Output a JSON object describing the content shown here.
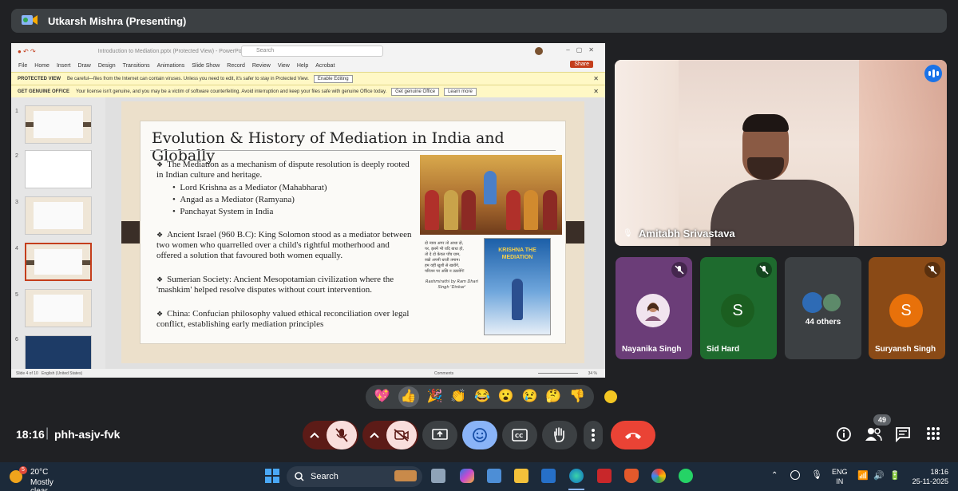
{
  "presenter": {
    "title": "Utkarsh Mishra (Presenting)"
  },
  "powerpoint": {
    "doc_title": "Introduction to Mediation.pptx (Protected View) - PowerPoint",
    "search_placeholder": "Search",
    "menu": [
      "File",
      "Home",
      "Insert",
      "Draw",
      "Design",
      "Transitions",
      "Animations",
      "Slide Show",
      "Record",
      "Review",
      "View",
      "Help",
      "Acrobat"
    ],
    "share_label": "Share",
    "protected_view": {
      "label": "PROTECTED VIEW",
      "message": "Be careful—files from the Internet can contain viruses. Unless you need to edit, it's safer to stay in Protected View.",
      "button": "Enable Editing"
    },
    "genuine": {
      "label": "GET GENUINE OFFICE",
      "message": "Your license isn't genuine, and you may be a victim of software counterfeiting. Avoid interruption and keep your files safe with genuine Office today.",
      "button1": "Get genuine Office",
      "button2": "Learn more"
    },
    "thumbnails": [
      {
        "num": "1",
        "selected": false
      },
      {
        "num": "2",
        "selected": false
      },
      {
        "num": "3",
        "selected": false
      },
      {
        "num": "4",
        "selected": true
      },
      {
        "num": "5",
        "selected": false
      },
      {
        "num": "6",
        "selected": false
      }
    ],
    "status": {
      "slide": "Slide 4 of 10",
      "lang": "English (United States)",
      "notes": "Comments",
      "zoom": "34 %"
    }
  },
  "slide": {
    "title": "Evolution & History of Mediation in India and Globally",
    "bullet1": "The Mediation as a mechanism of dispute resolution is deeply rooted in Indian culture and heritage.",
    "sub1": "Lord Krishna as a Mediator (Mahabharat)",
    "sub2": "Angad as a Mediator (Ramyana)",
    "sub3": "Panchayat System in India",
    "bullet2": "Ancient Israel (960 B.C): King Solomon stood as a mediator between two women who quarrelled over a child's rightful motherhood and offered a solution that favoured both women equally.",
    "bullet3": "Sumerian Society: Ancient Mesopotamian civilization where the 'mashkim' helped resolve disputes without court intervention.",
    "bullet4": "China: Confucian philosophy valued ethical reconciliation over legal conflict, establishing early mediation principles",
    "poem_caption": "Rashmirathi by Ram Dhari Singh 'Dinkar'",
    "book_title": "KRISHNA THE MEDIATION"
  },
  "participants": {
    "main_video": {
      "name": "Amitabh Srivastava"
    },
    "tiles": [
      {
        "name": "Nayanika Singh",
        "initial": "",
        "color": "#6b3d78"
      },
      {
        "name": "Sid Hard",
        "initial": "S",
        "color": "#1e6b2e"
      },
      {
        "name": "44 others",
        "initial": "",
        "color": "#3c4043"
      },
      {
        "name": "Suryansh Singh",
        "initial": "S",
        "color": "#8a4a16"
      }
    ]
  },
  "reactions": [
    "💖",
    "👍",
    "🎉",
    "👏",
    "😂",
    "😮",
    "😢",
    "🤔",
    "👎"
  ],
  "meeting": {
    "time": "18:16",
    "code": "phh-asjv-fvk",
    "participants_count": "49",
    "colors": {
      "end_call": "#ea4335",
      "muted": "#f9dedc",
      "active": "#8ab4f8"
    }
  },
  "taskbar": {
    "temp": "20°C",
    "weather": "Mostly clear",
    "weather_badge": "5",
    "search": "Search",
    "lang1": "ENG",
    "lang2": "IN",
    "clock_time": "18:16",
    "clock_date": "25-11-2025"
  }
}
